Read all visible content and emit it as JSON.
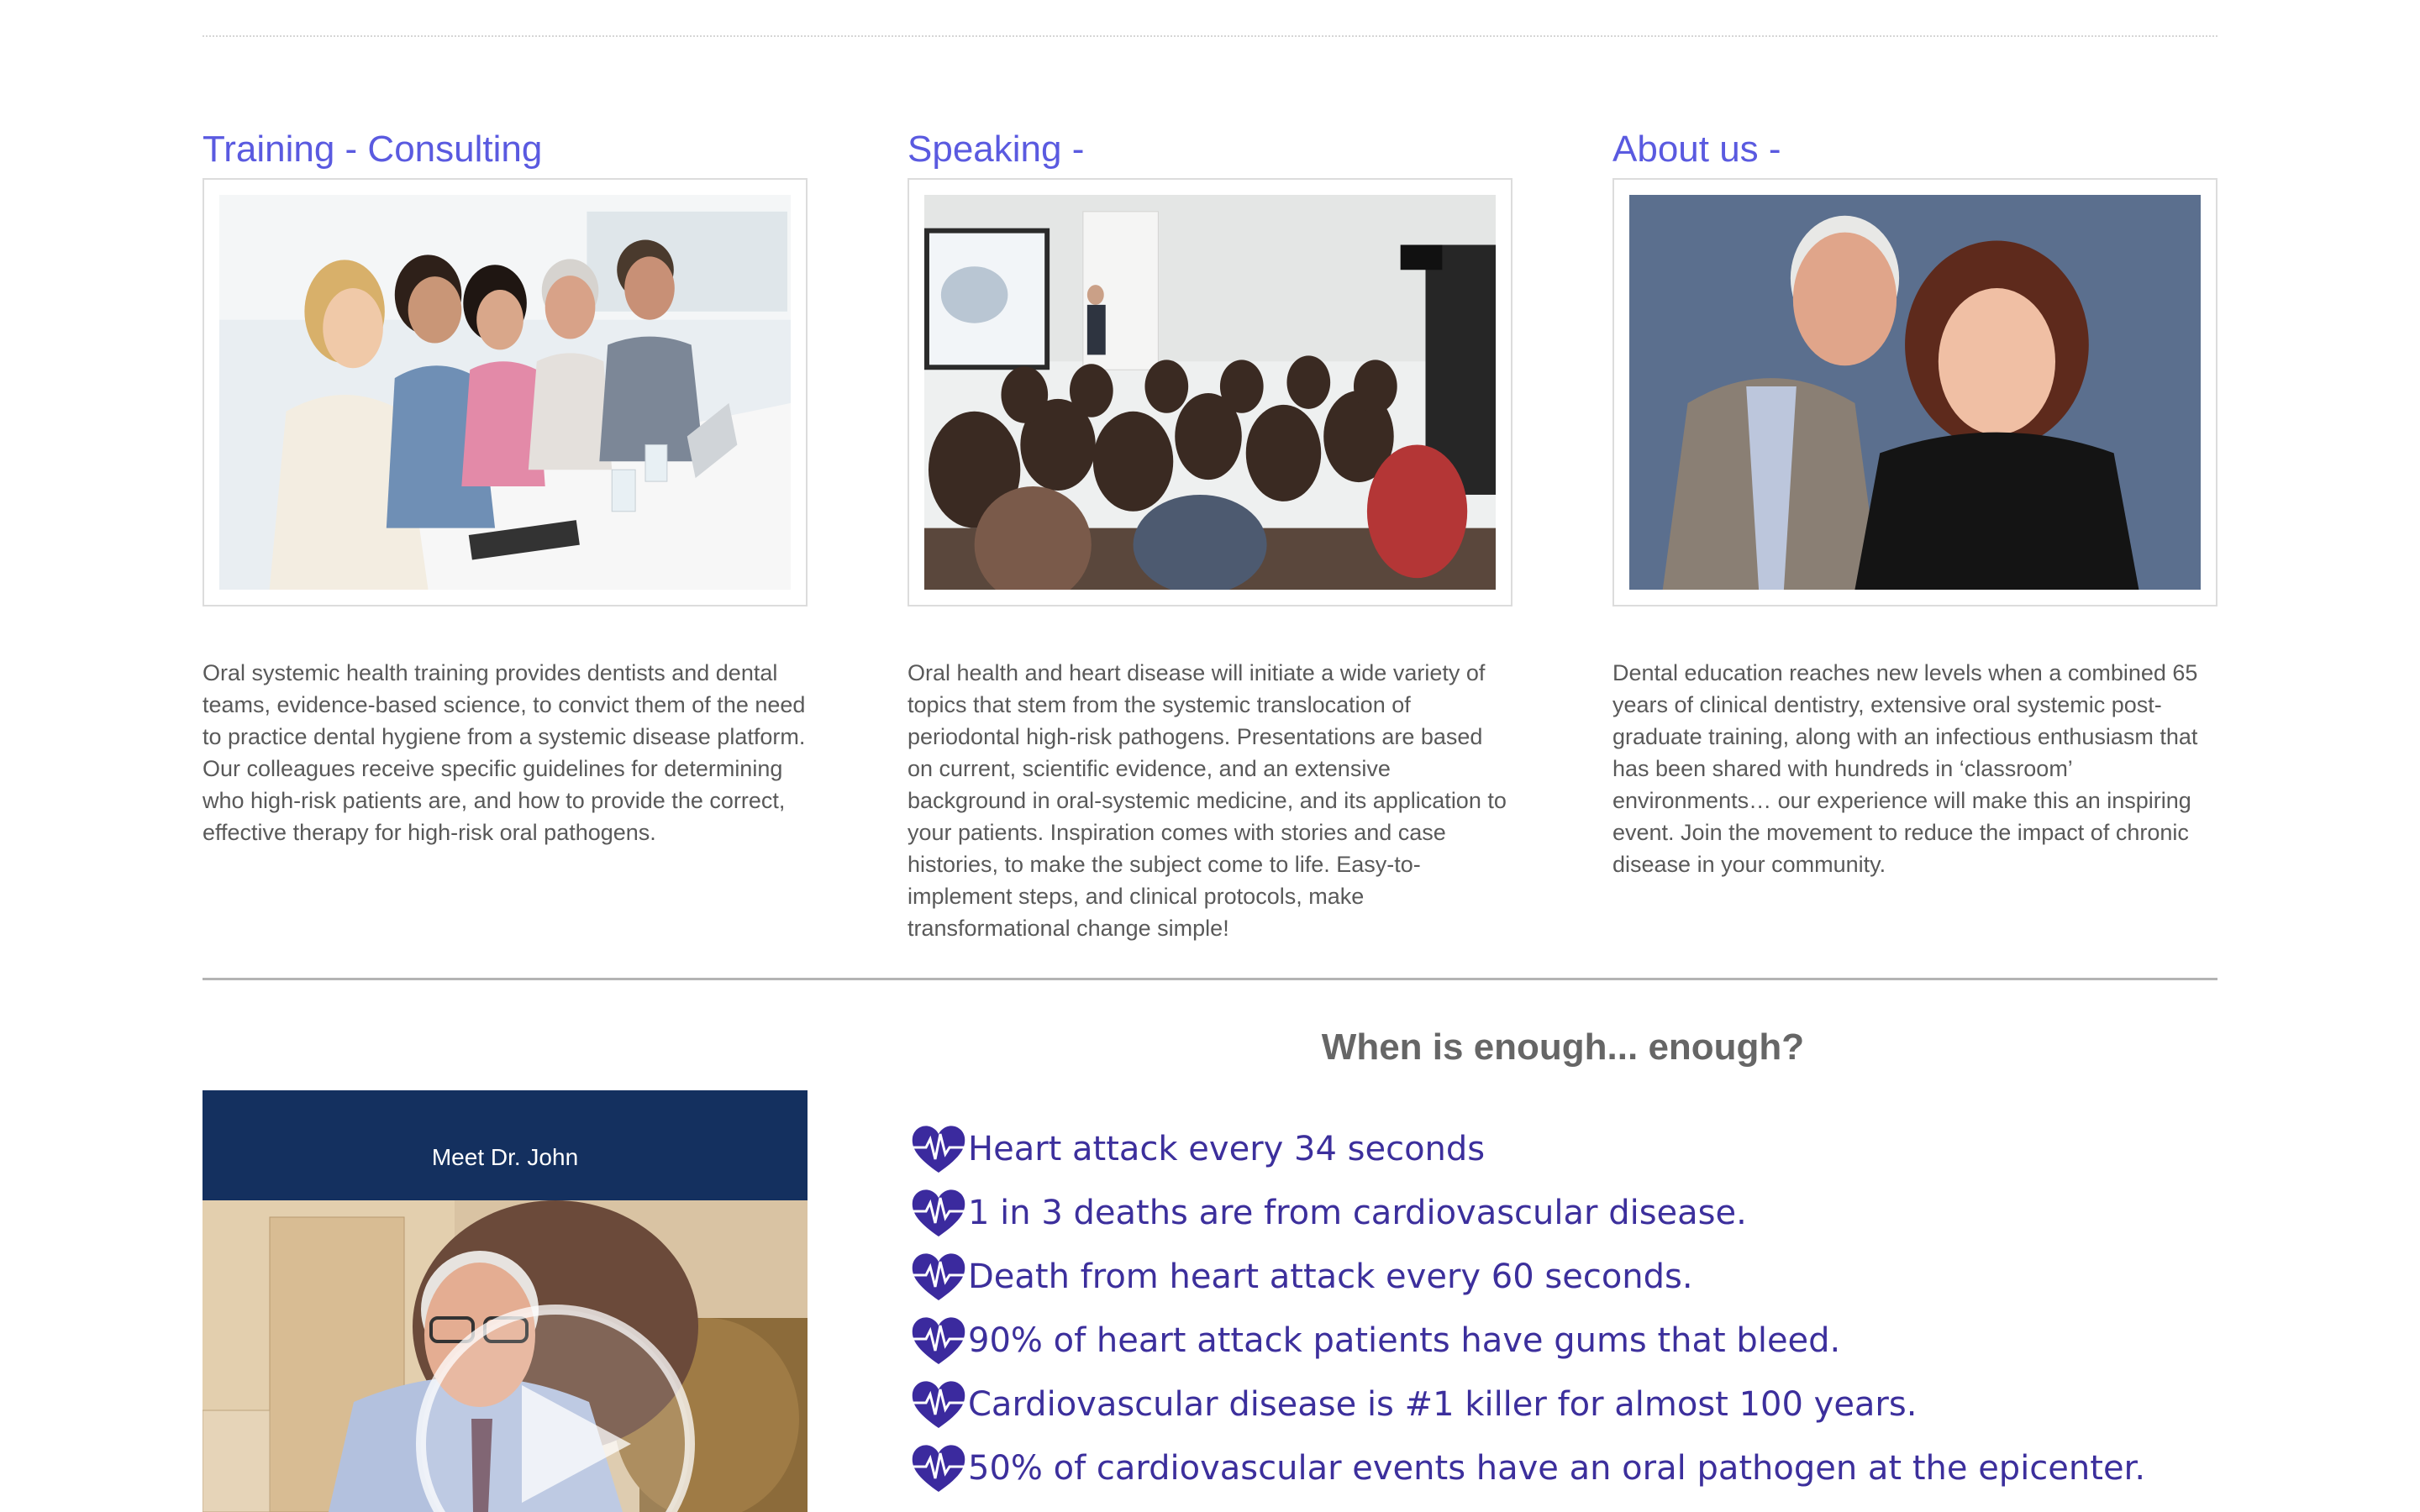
{
  "columns": [
    {
      "title": "Training - Consulting",
      "image": "team-meeting-photo",
      "text": "Oral systemic health training provides dentists and dental teams, evidence-based science, to convict them of the need to practice dental hygiene from a systemic disease platform. Our colleagues receive specific guidelines for determining who high-risk patients are, and how to provide the correct, effective therapy for high-risk oral pathogens."
    },
    {
      "title": "Speaking -",
      "image": "lecture-audience-photo",
      "text": "Oral health and heart disease will initiate a wide variety of topics that stem from the systemic translocation of periodontal high-risk pathogens. Presentations are based on current, scientific evidence, and an extensive background in oral-systemic medicine, and its application to your patients. Inspiration comes with stories and case histories, to make the subject come to life. Easy-to-implement steps, and clinical protocols, make transformational change simple!"
    },
    {
      "title": "About us -",
      "image": "couple-portrait-photo",
      "text": "Dental education reaches new levels when a combined 65 years of clinical dentistry, extensive oral systemic post-graduate training, along with an infectious enthusiasm that has been shared with hundreds in ‘classroom’ environments… our experience will make this an inspiring event. Join the movement to reduce the impact of chronic disease in your community."
    }
  ],
  "video": {
    "title": "Meet Dr. John",
    "icon": "play-icon"
  },
  "facts_section": {
    "title": "When is enough... enough?",
    "icon": "heart-pulse-icon",
    "items": [
      "Heart attack every 34 seconds",
      "1 in 3 deaths are from cardiovascular disease.",
      "Death from heart attack every 60 seconds.",
      "90% of heart attack patients have gums that bleed.",
      "Cardiovascular disease is #1 killer for almost 100 years.",
      "50% of cardiovascular events have an oral pathogen at the epicenter."
    ]
  },
  "colors": {
    "title_blue": "#5a5ae0",
    "fact_purple": "#3c2f9c",
    "video_header_navy": "#14305f",
    "about_backdrop": "#5b6f8e"
  }
}
